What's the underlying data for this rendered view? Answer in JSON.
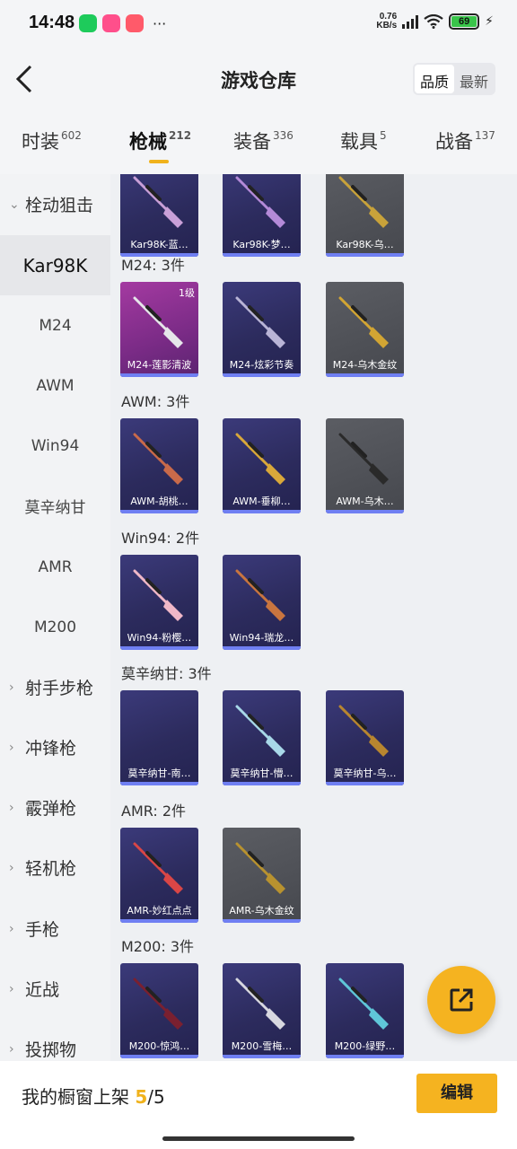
{
  "status": {
    "time": "14:48",
    "speed_value": "0.76",
    "speed_unit": "KB/s",
    "battery": "69",
    "more": "···"
  },
  "header": {
    "title": "游戏仓库",
    "sort_options": [
      "品质",
      "最新"
    ],
    "sort_selected": "品质"
  },
  "tabs": [
    {
      "label": "时装",
      "count": "602"
    },
    {
      "label": "枪械",
      "count": "212",
      "active": true
    },
    {
      "label": "装备",
      "count": "336"
    },
    {
      "label": "载具",
      "count": "5"
    },
    {
      "label": "战备",
      "count": "137"
    }
  ],
  "sidebar": {
    "group_open": "栓动狙击",
    "items": [
      "Kar98K",
      "M24",
      "AWM",
      "Win94",
      "莫辛纳甘",
      "AMR",
      "M200"
    ],
    "selected": "Kar98K",
    "groups": [
      "射手步枪",
      "冲锋枪",
      "霰弹枪",
      "轻机枪",
      "手枪",
      "近战",
      "投掷物"
    ]
  },
  "sections": [
    {
      "title": "",
      "items": [
        {
          "label": "Kar98K-蓝…",
          "style": "purple",
          "gun_color": "#c9a0d8"
        },
        {
          "label": "Kar98K-梦…",
          "style": "purple",
          "gun_color": "#b48ad8"
        },
        {
          "label": "Kar98K-乌…",
          "style": "gray",
          "gun_color": "#c8a23a"
        }
      ]
    },
    {
      "title": "M24: 3件",
      "items": [
        {
          "label": "M24-莲影清波",
          "style": "pink",
          "level": "1级",
          "gun_color": "#e6e6ea"
        },
        {
          "label": "M24-炫彩节奏",
          "style": "purple",
          "gun_color": "#b9b4d6"
        },
        {
          "label": "M24-乌木金纹",
          "style": "gray",
          "gun_color": "#d2a533"
        }
      ]
    },
    {
      "title": "AWM: 3件",
      "items": [
        {
          "label": "AWM-胡桃…",
          "style": "purple",
          "gun_color": "#c96a4a"
        },
        {
          "label": "AWM-垂柳…",
          "style": "purple",
          "gun_color": "#d9a83a"
        },
        {
          "label": "AWM-乌木…",
          "style": "gray",
          "gun_color": "#2a2a2a"
        }
      ]
    },
    {
      "title": "Win94: 2件",
      "items": [
        {
          "label": "Win94-粉樱…",
          "style": "purple",
          "gun_color": "#f0b8c8"
        },
        {
          "label": "Win94-瑞龙…",
          "style": "purple",
          "gun_color": "#c9753f"
        }
      ]
    },
    {
      "title": "莫辛纳甘: 3件",
      "items": [
        {
          "label": "莫辛纳甘-南…",
          "style": "purple",
          "gun_color": ""
        },
        {
          "label": "莫辛纳甘-懵…",
          "style": "purple",
          "gun_color": "#a8d8e8"
        },
        {
          "label": "莫辛纳甘-乌…",
          "style": "purple",
          "gun_color": "#b8862f"
        }
      ]
    },
    {
      "title": "AMR: 2件",
      "items": [
        {
          "label": "AMR-妙红点点",
          "style": "purple",
          "gun_color": "#d94646"
        },
        {
          "label": "AMR-乌木金纹",
          "style": "gray",
          "gun_color": "#b8922f"
        }
      ]
    },
    {
      "title": "M200: 3件",
      "items": [
        {
          "label": "M200-惊鸿…",
          "style": "purple",
          "gun_color": "#7a2030"
        },
        {
          "label": "M200-雪梅…",
          "style": "purple",
          "gun_color": "#d8d8e0"
        },
        {
          "label": "M200-绿野…",
          "style": "purple",
          "gun_color": "#5fc6d8"
        }
      ]
    }
  ],
  "bottom": {
    "text": "我的橱窗上架 ",
    "current": "5",
    "total": "/5",
    "edit_label": "编辑"
  }
}
